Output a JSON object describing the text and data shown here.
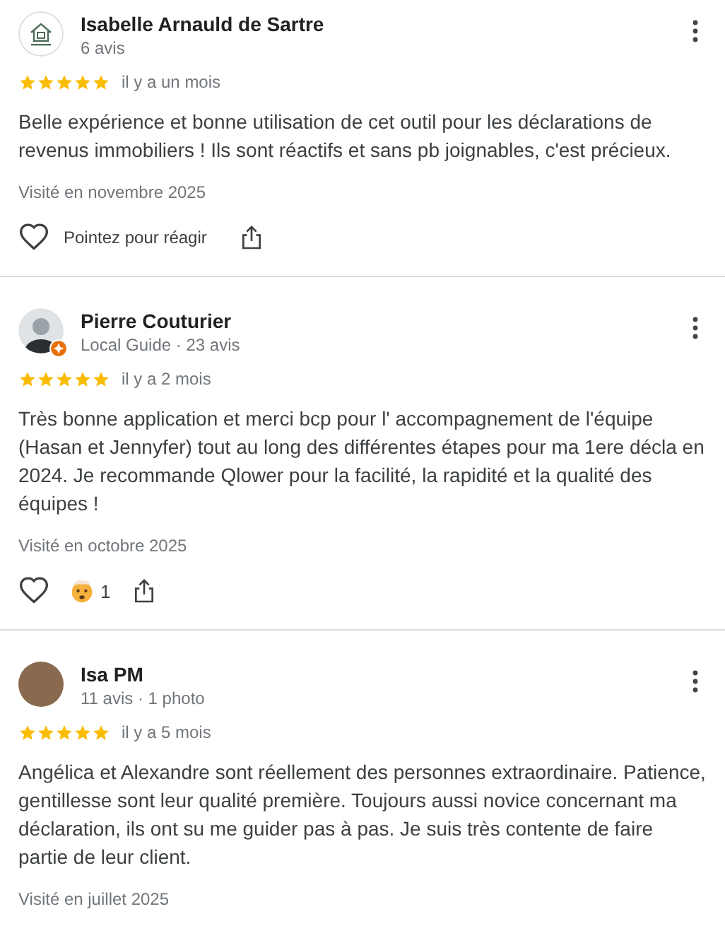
{
  "reviews": [
    {
      "name": "Isabelle Arnauld de Sartre",
      "meta": "6 avis",
      "avatar": {
        "kind": "logo"
      },
      "local_guide": false,
      "stars": 5,
      "date": "il y a un mois",
      "text": "Belle expérience et bonne utilisation de cet outil pour les déclarations de revenus immobiliers ! Ils sont réactifs et sans pb joignables, c'est précieux.",
      "visited": "Visité en novembre 2025",
      "actions": {
        "reaction_prompt": "Pointez pour réagir"
      }
    },
    {
      "name": "Pierre Couturier",
      "meta": "Local Guide · 23 avis",
      "avatar": {
        "kind": "person"
      },
      "local_guide": true,
      "stars": 5,
      "date": "il y a 2 mois",
      "text": "Très bonne application et merci bcp pour l' accompagnement de l'équipe (Hasan et Jennyfer) tout au long des différentes étapes pour ma 1ere décla en 2024. Je recommande Qlower pour la facilité, la rapidité et la qualité des équipes !",
      "visited": "Visité en octobre 2025",
      "actions": {
        "reactions": [
          {
            "count": "1"
          }
        ]
      }
    },
    {
      "name": "Isa PM",
      "meta": "11 avis · 1 photo",
      "avatar": {
        "kind": "photo"
      },
      "local_guide": false,
      "stars": 5,
      "date": "il y a 5 mois",
      "text": "Angélica et Alexandre sont réellement des personnes extraordinaire. Patience, gentillesse sont leur qualité première. Toujours aussi novice concernant ma déclaration, ils ont su me guider pas à pas. Je suis très contente de faire partie de leur client.",
      "visited": "Visité en juillet 2025"
    }
  ]
}
